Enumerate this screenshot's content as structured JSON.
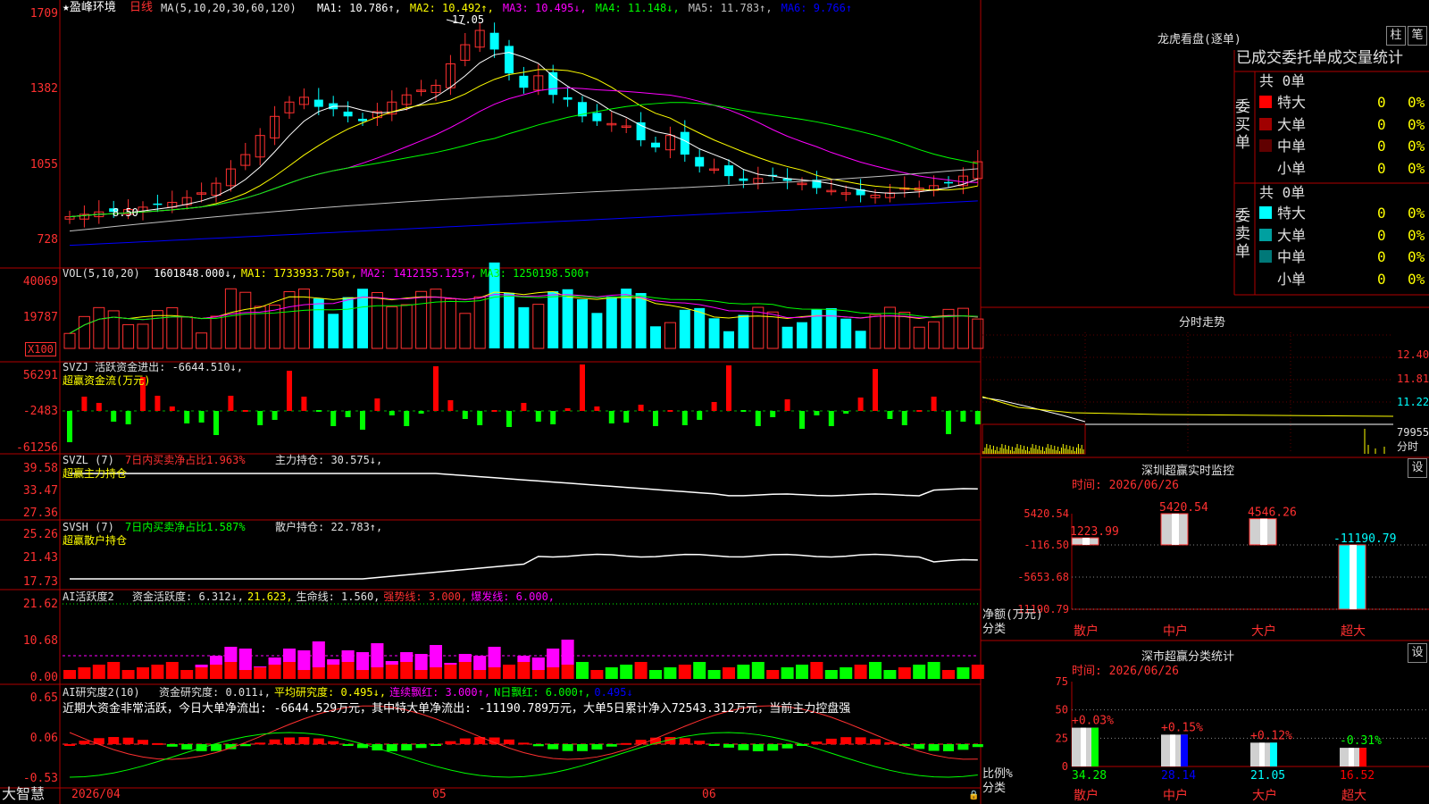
{
  "app": {
    "brand": "大智慧"
  },
  "kline": {
    "title": "★盈峰环境",
    "period": "日线",
    "ma_label": "MA(5,10,20,30,60,120)",
    "ma_items": [
      {
        "text": "MA1: 10.786↑,",
        "color": "#ffffff"
      },
      {
        "text": "MA2: 10.492↑,",
        "color": "#ffff00"
      },
      {
        "text": "MA3: 10.495↓,",
        "color": "#ff00ff"
      },
      {
        "text": "MA4: 11.148↓,",
        "color": "#00ff00"
      },
      {
        "text": "MA5: 11.783↑,",
        "color": "#c0c0c0"
      },
      {
        "text": "MA6: 9.766↑",
        "color": "#0000ff"
      }
    ],
    "y_ticks": [
      "1709",
      "1382",
      "1055",
      "728"
    ],
    "high_label": "17.05",
    "low_label": "8.50"
  },
  "vol": {
    "label": "VOL(5,10,20)",
    "items": [
      {
        "text": "1601848.000↓,",
        "color": "#ffffff"
      },
      {
        "text": "MA1: 1733933.750↑,",
        "color": "#ffff00"
      },
      {
        "text": "MA2: 1412155.125↑,",
        "color": "#ff00ff"
      },
      {
        "text": "MA3: 1250198.500↑",
        "color": "#00ff00"
      }
    ],
    "y_ticks": [
      "40069",
      "19787"
    ],
    "unit": "X100"
  },
  "svzj": {
    "label": "SVZJ  活跃资金进出: -6644.510↓,",
    "sub": "超赢资金流(万元)",
    "y_ticks": [
      "56291",
      "-2483",
      "-61256"
    ]
  },
  "svzl": {
    "label": "SVZL (7)",
    "pct": "7日内买卖净占比1.963%",
    "hold": "主力持仓: 30.575↓,",
    "sub": "超赢主力持仓",
    "y_ticks": [
      "39.58",
      "33.47",
      "27.36"
    ]
  },
  "svsh": {
    "label": "SVSH (7)",
    "pct": "7日内买卖净占比1.587%",
    "hold": "散户持仓: 22.783↑,",
    "sub": "超赢散户持仓",
    "y_ticks": [
      "25.26",
      "21.43",
      "17.73"
    ]
  },
  "ai_active": {
    "label": "AI活跃度2",
    "items": [
      {
        "text": "资金活跃度: 6.312↓,",
        "color": "#e0e0e0"
      },
      {
        "text": "21.623,",
        "color": "#ffff00"
      },
      {
        "text": "生命线: 1.560,",
        "color": "#e0e0e0"
      },
      {
        "text": "强势线: 3.000,",
        "color": "#ff3030"
      },
      {
        "text": "爆发线: 6.000,",
        "color": "#ff00ff"
      }
    ],
    "y_ticks": [
      "21.62",
      "10.68",
      "0.00"
    ]
  },
  "ai_research": {
    "label": "AI研究度2(10)",
    "items": [
      {
        "text": "资金研究度: 0.011↓,",
        "color": "#e0e0e0"
      },
      {
        "text": "平均研究度: 0.495↓,",
        "color": "#ffff00"
      },
      {
        "text": "连续飘红: 3.000↑,",
        "color": "#ff00ff"
      },
      {
        "text": "N日飘红: 6.000↑,",
        "color": "#00ff00"
      },
      {
        "text": "0.495↓",
        "color": "#0000ff"
      }
    ],
    "summary": "近期大资金非常活跃，今日大单净流出: -6644.529万元，其中特大单净流出: -11190.789万元，大单5日累计净入72543.312万元，当前主力控盘强",
    "y_ticks": [
      "0.65",
      "0.06",
      "-0.53"
    ]
  },
  "x_axis": {
    "labels": [
      "2026/04",
      "05",
      "06"
    ]
  },
  "dragon": {
    "title": "龙虎看盘(逐单)",
    "btn_bar": "柱",
    "btn_pen": "笔",
    "header": "已成交委托单成交量统计",
    "buy_side": "委买单",
    "sell_side": "委卖单",
    "buy_total": "共 0单",
    "sell_total": "共 0单",
    "buy_rows": [
      {
        "label": "特大",
        "count": "0",
        "pct": "0%",
        "color": "#ff0000"
      },
      {
        "label": "大单",
        "count": "0",
        "pct": "0%",
        "color": "#a00000"
      },
      {
        "label": "中单",
        "count": "0",
        "pct": "0%",
        "color": "#600000"
      },
      {
        "label": "小单",
        "count": "0",
        "pct": "0%",
        "color": "#000000"
      }
    ],
    "sell_rows": [
      {
        "label": "特大",
        "count": "0",
        "pct": "0%",
        "color": "#00ffff"
      },
      {
        "label": "大单",
        "count": "0",
        "pct": "0%",
        "color": "#00a0a0"
      },
      {
        "label": "中单",
        "count": "0",
        "pct": "0%",
        "color": "#007878"
      },
      {
        "label": "小单",
        "count": "0",
        "pct": "0%",
        "color": "#000000"
      }
    ]
  },
  "intraday": {
    "title": "分时走势",
    "y_labels": [
      "12.40",
      "11.81",
      "11.22",
      "79955"
    ],
    "fenshi": "分时"
  },
  "sz_monitor": {
    "title": "深圳超赢实时监控",
    "btn": "设",
    "time": "时间: 2026/06/26",
    "y_ticks": [
      "5420.54",
      "-116.50",
      "-5653.68",
      "-11190.79"
    ],
    "axis_title": [
      "净额(万元)",
      "分类"
    ],
    "categories": [
      "散户",
      "中户",
      "大户",
      "超大"
    ],
    "values": [
      1223.99,
      5420.54,
      4546.26,
      -11190.79
    ],
    "value_labels": [
      "1223.99",
      "5420.54",
      "4546.26",
      "-11190.79"
    ]
  },
  "sz_class": {
    "title": "深市超赢分类统计",
    "btn": "设",
    "time": "时间: 2026/06/26",
    "y_ticks": [
      "75",
      "50",
      "25",
      "0"
    ],
    "axis_title": [
      "比例%",
      "分类"
    ],
    "categories": [
      "散户",
      "中户",
      "大户",
      "超大"
    ],
    "values": [
      34.28,
      28.14,
      21.05,
      16.52
    ],
    "changes": [
      "+0.03%",
      "+0.15%",
      "+0.12%",
      "-0.31%"
    ],
    "bar_colors": [
      "#00ff00",
      "#0000ff",
      "#00ffff",
      "#ff0000"
    ]
  },
  "chart_data": [
    {
      "type": "line",
      "title": "深圳超赢实时监控",
      "categories": [
        "散户",
        "中户",
        "大户",
        "超大"
      ],
      "values": [
        1223.99,
        5420.54,
        4546.26,
        -11190.79
      ],
      "ylim": [
        -11190.79,
        5420.54
      ]
    },
    {
      "type": "bar",
      "title": "深市超赢分类统计",
      "categories": [
        "散户",
        "中户",
        "大户",
        "超大"
      ],
      "values": [
        34.28,
        28.14,
        21.05,
        16.52
      ],
      "ylim": [
        0,
        75
      ]
    }
  ]
}
